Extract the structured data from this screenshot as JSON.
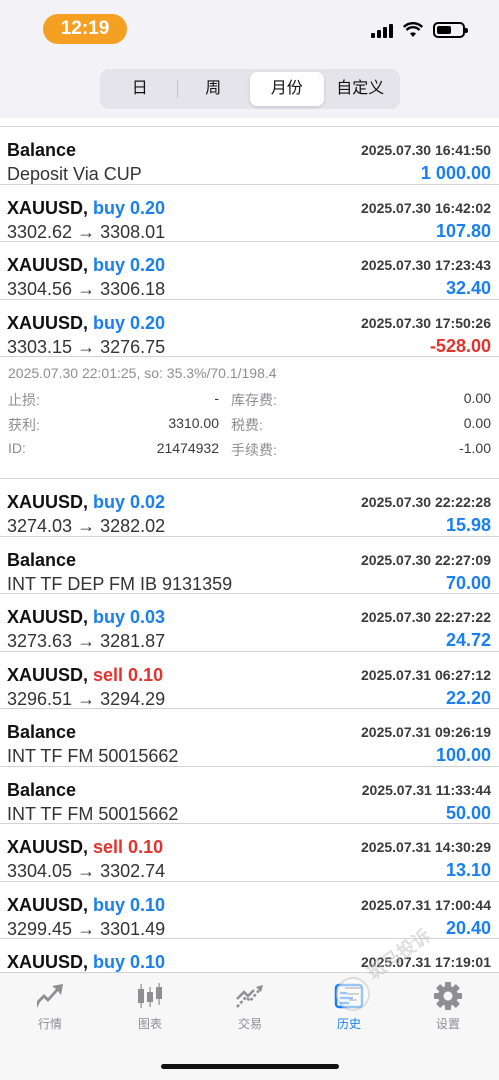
{
  "status": {
    "time": "12:19"
  },
  "periods": [
    "日",
    "周",
    "月份",
    "自定义"
  ],
  "active_period": "月份",
  "rows_before": [
    {
      "title": "Balance",
      "date": "2025.07.30 16:41:50",
      "sub": "Deposit Via CUP",
      "amount": "1 000.00",
      "sign": "pos"
    },
    {
      "title": "XAUUSD,",
      "dir": "buy 0.20",
      "dir_type": "buy",
      "date": "2025.07.30 16:42:02",
      "sub": "3302.62 → 3308.01",
      "amount": "107.80",
      "sign": "pos"
    },
    {
      "title": "XAUUSD,",
      "dir": "buy 0.20",
      "dir_type": "buy",
      "date": "2025.07.30 17:23:43",
      "sub": "3304.56 → 3306.18",
      "amount": "32.40",
      "sign": "pos"
    },
    {
      "title": "XAUUSD,",
      "dir": "buy 0.20",
      "dir_type": "buy",
      "date": "2025.07.30 17:50:26",
      "sub": "3303.15 → 3276.75",
      "amount": "-528.00",
      "sign": "neg"
    }
  ],
  "detail": {
    "info": "2025.07.30 22:01:25, so: 35.3%/70.1/198.4",
    "stop_loss_label": "止损:",
    "stop_loss": "-",
    "swap_label": "库存费:",
    "swap": "0.00",
    "take_profit_label": "获利:",
    "take_profit": "3310.00",
    "tax_label": "税费:",
    "tax": "0.00",
    "id_label": "ID:",
    "id": "21474932",
    "fee_label": "手续费:",
    "fee": "-1.00"
  },
  "rows_after": [
    {
      "title": "XAUUSD,",
      "dir": "buy 0.02",
      "dir_type": "buy",
      "date": "2025.07.30 22:22:28",
      "sub": "3274.03 → 3282.02",
      "amount": "15.98",
      "sign": "pos"
    },
    {
      "title": "Balance",
      "date": "2025.07.30 22:27:09",
      "sub": "INT TF DEP FM IB 9131359",
      "amount": "70.00",
      "sign": "pos"
    },
    {
      "title": "XAUUSD,",
      "dir": "buy 0.03",
      "dir_type": "buy",
      "date": "2025.07.30 22:27:22",
      "sub": "3273.63 → 3281.87",
      "amount": "24.72",
      "sign": "pos"
    },
    {
      "title": "XAUUSD,",
      "dir": "sell 0.10",
      "dir_type": "sell",
      "date": "2025.07.31 06:27:12",
      "sub": "3296.51 → 3294.29",
      "amount": "22.20",
      "sign": "pos"
    },
    {
      "title": "Balance",
      "date": "2025.07.31 09:26:19",
      "sub": "INT TF FM 50015662",
      "amount": "100.00",
      "sign": "pos"
    },
    {
      "title": "Balance",
      "date": "2025.07.31 11:33:44",
      "sub": "INT TF FM 50015662",
      "amount": "50.00",
      "sign": "pos"
    },
    {
      "title": "XAUUSD,",
      "dir": "sell 0.10",
      "dir_type": "sell",
      "date": "2025.07.31 14:30:29",
      "sub": "3304.05 → 3302.74",
      "amount": "13.10",
      "sign": "pos"
    },
    {
      "title": "XAUUSD,",
      "dir": "buy 0.10",
      "dir_type": "buy",
      "date": "2025.07.31 17:00:44",
      "sub": "3299.45 → 3301.49",
      "amount": "20.40",
      "sign": "pos"
    },
    {
      "title": "XAUUSD,",
      "dir": "buy 0.10",
      "dir_type": "buy",
      "date": "2025.07.31 17:19:01",
      "sub": "",
      "amount": "",
      "sign": "pos"
    }
  ],
  "tabs": [
    {
      "label": "行情",
      "icon": "quotes-icon",
      "active": false
    },
    {
      "label": "图表",
      "icon": "chart-icon",
      "active": false
    },
    {
      "label": "交易",
      "icon": "trade-icon",
      "active": false
    },
    {
      "label": "历史",
      "icon": "history-icon",
      "active": true
    },
    {
      "label": "设置",
      "icon": "settings-icon",
      "active": false
    }
  ],
  "watermark_text": "斑马投诉",
  "colors": {
    "positive": "#1a7ff0",
    "negative": "#e5322d",
    "time_pill": "#f5a023"
  }
}
